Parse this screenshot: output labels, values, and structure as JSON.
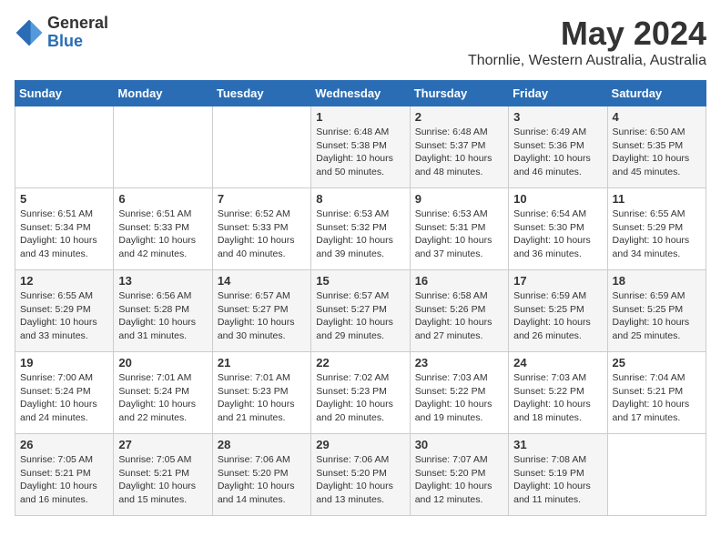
{
  "header": {
    "logo_general": "General",
    "logo_blue": "Blue",
    "month_title": "May 2024",
    "location": "Thornlie, Western Australia, Australia"
  },
  "weekdays": [
    "Sunday",
    "Monday",
    "Tuesday",
    "Wednesday",
    "Thursday",
    "Friday",
    "Saturday"
  ],
  "weeks": [
    [
      {
        "day": "",
        "info": ""
      },
      {
        "day": "",
        "info": ""
      },
      {
        "day": "",
        "info": ""
      },
      {
        "day": "1",
        "info": "Sunrise: 6:48 AM\nSunset: 5:38 PM\nDaylight: 10 hours\nand 50 minutes."
      },
      {
        "day": "2",
        "info": "Sunrise: 6:48 AM\nSunset: 5:37 PM\nDaylight: 10 hours\nand 48 minutes."
      },
      {
        "day": "3",
        "info": "Sunrise: 6:49 AM\nSunset: 5:36 PM\nDaylight: 10 hours\nand 46 minutes."
      },
      {
        "day": "4",
        "info": "Sunrise: 6:50 AM\nSunset: 5:35 PM\nDaylight: 10 hours\nand 45 minutes."
      }
    ],
    [
      {
        "day": "5",
        "info": "Sunrise: 6:51 AM\nSunset: 5:34 PM\nDaylight: 10 hours\nand 43 minutes."
      },
      {
        "day": "6",
        "info": "Sunrise: 6:51 AM\nSunset: 5:33 PM\nDaylight: 10 hours\nand 42 minutes."
      },
      {
        "day": "7",
        "info": "Sunrise: 6:52 AM\nSunset: 5:33 PM\nDaylight: 10 hours\nand 40 minutes."
      },
      {
        "day": "8",
        "info": "Sunrise: 6:53 AM\nSunset: 5:32 PM\nDaylight: 10 hours\nand 39 minutes."
      },
      {
        "day": "9",
        "info": "Sunrise: 6:53 AM\nSunset: 5:31 PM\nDaylight: 10 hours\nand 37 minutes."
      },
      {
        "day": "10",
        "info": "Sunrise: 6:54 AM\nSunset: 5:30 PM\nDaylight: 10 hours\nand 36 minutes."
      },
      {
        "day": "11",
        "info": "Sunrise: 6:55 AM\nSunset: 5:29 PM\nDaylight: 10 hours\nand 34 minutes."
      }
    ],
    [
      {
        "day": "12",
        "info": "Sunrise: 6:55 AM\nSunset: 5:29 PM\nDaylight: 10 hours\nand 33 minutes."
      },
      {
        "day": "13",
        "info": "Sunrise: 6:56 AM\nSunset: 5:28 PM\nDaylight: 10 hours\nand 31 minutes."
      },
      {
        "day": "14",
        "info": "Sunrise: 6:57 AM\nSunset: 5:27 PM\nDaylight: 10 hours\nand 30 minutes."
      },
      {
        "day": "15",
        "info": "Sunrise: 6:57 AM\nSunset: 5:27 PM\nDaylight: 10 hours\nand 29 minutes."
      },
      {
        "day": "16",
        "info": "Sunrise: 6:58 AM\nSunset: 5:26 PM\nDaylight: 10 hours\nand 27 minutes."
      },
      {
        "day": "17",
        "info": "Sunrise: 6:59 AM\nSunset: 5:25 PM\nDaylight: 10 hours\nand 26 minutes."
      },
      {
        "day": "18",
        "info": "Sunrise: 6:59 AM\nSunset: 5:25 PM\nDaylight: 10 hours\nand 25 minutes."
      }
    ],
    [
      {
        "day": "19",
        "info": "Sunrise: 7:00 AM\nSunset: 5:24 PM\nDaylight: 10 hours\nand 24 minutes."
      },
      {
        "day": "20",
        "info": "Sunrise: 7:01 AM\nSunset: 5:24 PM\nDaylight: 10 hours\nand 22 minutes."
      },
      {
        "day": "21",
        "info": "Sunrise: 7:01 AM\nSunset: 5:23 PM\nDaylight: 10 hours\nand 21 minutes."
      },
      {
        "day": "22",
        "info": "Sunrise: 7:02 AM\nSunset: 5:23 PM\nDaylight: 10 hours\nand 20 minutes."
      },
      {
        "day": "23",
        "info": "Sunrise: 7:03 AM\nSunset: 5:22 PM\nDaylight: 10 hours\nand 19 minutes."
      },
      {
        "day": "24",
        "info": "Sunrise: 7:03 AM\nSunset: 5:22 PM\nDaylight: 10 hours\nand 18 minutes."
      },
      {
        "day": "25",
        "info": "Sunrise: 7:04 AM\nSunset: 5:21 PM\nDaylight: 10 hours\nand 17 minutes."
      }
    ],
    [
      {
        "day": "26",
        "info": "Sunrise: 7:05 AM\nSunset: 5:21 PM\nDaylight: 10 hours\nand 16 minutes."
      },
      {
        "day": "27",
        "info": "Sunrise: 7:05 AM\nSunset: 5:21 PM\nDaylight: 10 hours\nand 15 minutes."
      },
      {
        "day": "28",
        "info": "Sunrise: 7:06 AM\nSunset: 5:20 PM\nDaylight: 10 hours\nand 14 minutes."
      },
      {
        "day": "29",
        "info": "Sunrise: 7:06 AM\nSunset: 5:20 PM\nDaylight: 10 hours\nand 13 minutes."
      },
      {
        "day": "30",
        "info": "Sunrise: 7:07 AM\nSunset: 5:20 PM\nDaylight: 10 hours\nand 12 minutes."
      },
      {
        "day": "31",
        "info": "Sunrise: 7:08 AM\nSunset: 5:19 PM\nDaylight: 10 hours\nand 11 minutes."
      },
      {
        "day": "",
        "info": ""
      }
    ]
  ]
}
